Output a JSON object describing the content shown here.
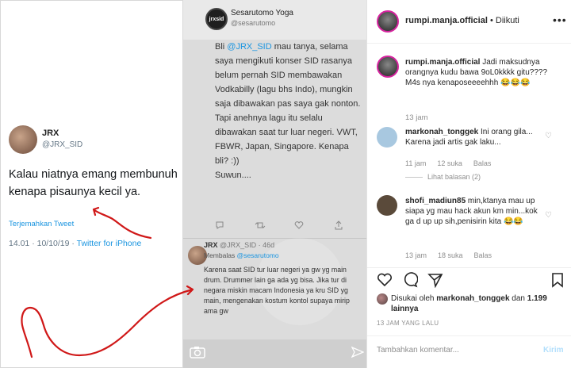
{
  "tweet": {
    "name": "JRX",
    "handle": "@JRX_SID",
    "text": "Kalau niatnya emang membunuh kenapa pisaunya kecil ya.",
    "translate": "Terjemahkan Tweet",
    "meta_time": "14.01 · 10/10/19 · ",
    "meta_via": "Twitter for iPhone"
  },
  "story": {
    "avatar_label": "jrxsid",
    "name": "Sesarutomo Yoga",
    "handle": "@sesarutomo",
    "body_prefix": "Bli ",
    "body_mention": "@JRX_SID",
    "body_rest": " mau tanya, selama saya mengikuti konser SID rasanya belum pernah SID membawakan Vodkabilly (lagu bhs Indo), mungkin saja dibawakan pas saya gak nonton. Tapi anehnya lagu itu selalu dibawakan saat tur luar negeri. VWT, FBWR, Japan, Singapore. Kenapa bli? :))",
    "body_end": "Suwun....",
    "reply_head": "JRX ",
    "reply_handle": "@JRX_SID · 46d",
    "reply_to_prefix": "Membalas ",
    "reply_to_mention": "@sesarutomo",
    "reply_body": "Karena saat SID tur luar negeri ya gw yg main drum. Drummer lain ga ada yg bisa. Jika tur di negara miskin macam Indonesia ya kru SID yg main, mengenakan kostum kontol supaya mirip ama gw"
  },
  "instagram": {
    "header_user": "rumpi.manja.official",
    "header_sep": " • ",
    "header_follow": "Diikuti",
    "more": "•••",
    "caption_user": "rumpi.manja.official",
    "caption_text": " Jadi maksudnya orangnya kudu bawa 9oL0kkkk gitu???? M4s nya kenaposeeeehhh 😂😂😂",
    "caption_time": "13 jam",
    "comments": [
      {
        "user": "markonah_tonggek",
        "text": " Ini orang gila... Karena jadi artis gak laku...",
        "time": "11 jam",
        "likes": "12 suka",
        "reply": "Balas",
        "avatar_color": "#a8c8e0"
      },
      {
        "user": "shofi_madiun85",
        "text": " min,ktanya mau up siapa yg mau hack akun km min...kok ga d up up sih,penisirin kita 😂😂",
        "time": "13 jam",
        "likes": "18 suka",
        "reply": "Balas",
        "avatar_color": "#5a4a3a"
      }
    ],
    "view_replies": "Lihat balasan (2)",
    "liked_prefix": "Disukai oleh ",
    "liked_user": "markonah_tonggek",
    "liked_mid": " dan ",
    "liked_count": "1.199 lainnya",
    "ago": "13 JAM YANG LALU",
    "comment_placeholder": "Tambahkan komentar...",
    "send_label": "Kirim"
  }
}
